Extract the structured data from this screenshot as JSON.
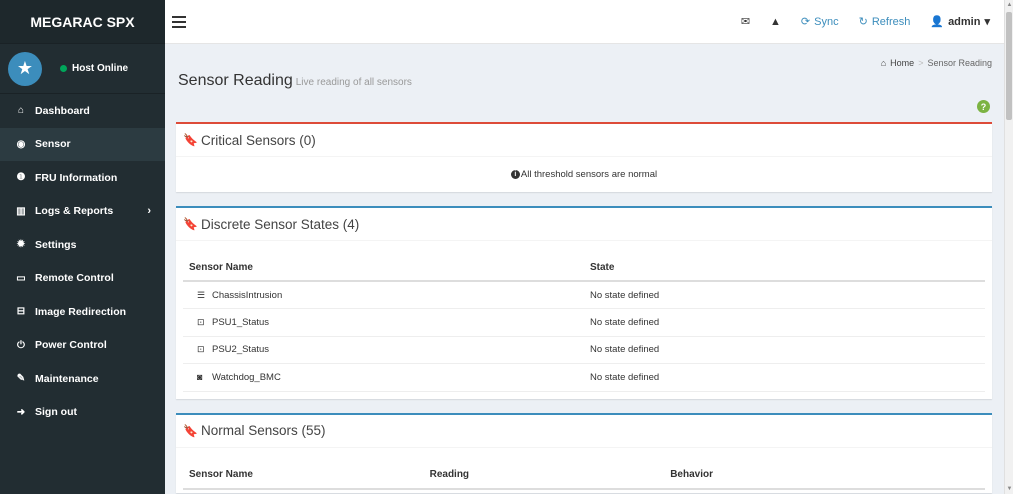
{
  "brand": "MEGARAC SPX",
  "host_status": "Host Online",
  "sidebar": {
    "items": [
      {
        "label": "Dashboard",
        "icon": "home-icon",
        "glyph": "⌂"
      },
      {
        "label": "Sensor",
        "icon": "sensor-icon",
        "glyph": "◉"
      },
      {
        "label": "FRU Information",
        "icon": "info-icon",
        "glyph": "❶"
      },
      {
        "label": "Logs & Reports",
        "icon": "bar-chart-icon",
        "glyph": "▥"
      },
      {
        "label": "Settings",
        "icon": "gear-icon",
        "glyph": "✹"
      },
      {
        "label": "Remote Control",
        "icon": "monitor-icon",
        "glyph": "▭"
      },
      {
        "label": "Image Redirection",
        "icon": "hdd-icon",
        "glyph": "⊟"
      },
      {
        "label": "Power Control",
        "icon": "power-icon",
        "glyph": "⏻"
      },
      {
        "label": "Maintenance",
        "icon": "wrench-icon",
        "glyph": "🔧"
      },
      {
        "label": "Sign out",
        "icon": "sign-out-icon",
        "glyph": "➜"
      }
    ],
    "active": "Sensor"
  },
  "header": {
    "sync_label": "Sync",
    "refresh_label": "Refresh",
    "user_label": "admin"
  },
  "page": {
    "title": "Sensor Reading",
    "subtitle": "Live reading of all sensors",
    "breadcrumb_home": "Home",
    "breadcrumb_sep": ">",
    "breadcrumb_current": "Sensor Reading"
  },
  "critical": {
    "title": "Critical Sensors (0)",
    "message": "All threshold sensors are normal"
  },
  "discrete": {
    "title": "Discrete Sensor States (4)",
    "columns": [
      "Sensor Name",
      "State"
    ],
    "rows": [
      {
        "name": "ChassisIntrusion",
        "state": "No state defined",
        "icon": "server-icon",
        "glyph": "☰"
      },
      {
        "name": "PSU1_Status",
        "state": "No state defined",
        "icon": "power-supply-icon",
        "glyph": "⊡"
      },
      {
        "name": "PSU2_Status",
        "state": "No state defined",
        "icon": "power-supply-icon",
        "glyph": "⊡"
      },
      {
        "name": "Watchdog_BMC",
        "state": "No state defined",
        "icon": "camera-icon",
        "glyph": "◙"
      }
    ]
  },
  "normal": {
    "title": "Normal Sensors (55)",
    "columns": [
      "Sensor Name",
      "Reading",
      "Behavior"
    ]
  },
  "colors": {
    "sidebar_bg": "#222d32",
    "accent_blue": "#3c8dbc",
    "critical_red": "#dd4b39",
    "online_green": "#00a65a"
  }
}
